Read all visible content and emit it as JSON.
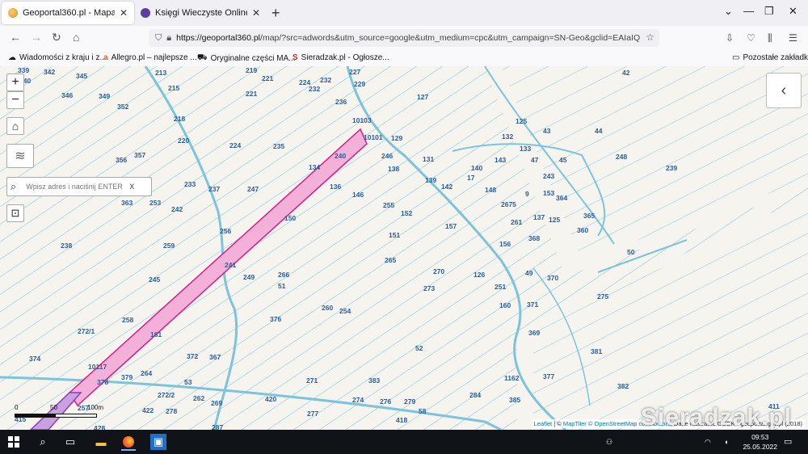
{
  "tabs": [
    {
      "title": "Geoportal360.pl - Mapa Interakt",
      "close": "✕",
      "active": true,
      "icon_color": "#f3b33d"
    },
    {
      "title": "Księgi Wieczyste Online - Ogólne",
      "close": "✕",
      "active": false,
      "icon_color": "#5b3fa0"
    }
  ],
  "window": {
    "new_tab": "+",
    "minimize": "—",
    "restore": "❐",
    "close": "✕",
    "tabs_menu": "⌄"
  },
  "nav": {
    "back": "←",
    "forward": "→",
    "reload": "↻",
    "home": "⌂",
    "url_host": "https://geoportal360.pl",
    "url_path": "/map/?src=adwords&utm_source=google&utm_medium=cpc&utm_campaign=SN-Geo&gclid=EAIaIQ",
    "star": "☆",
    "icons": [
      "download-icon",
      "pocket-icon",
      "library-icon",
      "menu-icon"
    ]
  },
  "bookmarks": [
    {
      "label": "Wiadomości z kraju i z...",
      "icon": "☁"
    },
    {
      "label": "Allegro.pl – najlepsze ...",
      "icon": "a"
    },
    {
      "label": "Oryginalne części MA...",
      "icon": "⛟"
    },
    {
      "label": "Sieradzak.pl - Ogłosze...",
      "icon": "S"
    },
    {
      "label": "Pozostałe zakładki",
      "icon": "▭"
    }
  ],
  "map_controls": {
    "zoom_in": "+",
    "zoom_out": "−",
    "home": "⌂",
    "layers": "≋",
    "print": "⊡",
    "search_placeholder": "Wpisz adres i naciśnij ENTER",
    "search_clear": "X",
    "search_icon": "⌕",
    "side_toggle": "‹"
  },
  "scale": {
    "labels": [
      "0",
      "50",
      "100m"
    ]
  },
  "plots": [
    "339",
    "342",
    "345",
    "213",
    "219",
    "221",
    "227",
    "232",
    "224",
    "232",
    "229",
    "42",
    "340",
    "346",
    "349",
    "215",
    "221",
    "236",
    "127",
    "352",
    "218",
    "10103",
    "125",
    "43",
    "44",
    "129",
    "220",
    "224",
    "235",
    "10101",
    "132",
    "356",
    "357",
    "240",
    "246",
    "131",
    "133",
    "45",
    "248",
    "138",
    "140",
    "143",
    "47",
    "239",
    "134",
    "139",
    "17",
    "243",
    "136",
    "142",
    "148",
    "9",
    "153",
    "364",
    "233",
    "237",
    "247",
    "146",
    "2675",
    "363",
    "253",
    "255",
    "152",
    "137",
    "125",
    "365",
    "242",
    "150",
    "261",
    "157",
    "360",
    "238",
    "256",
    "151",
    "156",
    "368",
    "259",
    "50",
    "241",
    "265",
    "270",
    "126",
    "49",
    "370",
    "245",
    "249",
    "266",
    "273",
    "251",
    "51",
    "275",
    "160",
    "371",
    "258",
    "260",
    "254",
    "376",
    "161",
    "369",
    "272/1",
    "52",
    "381",
    "372",
    "367",
    "374",
    "10117",
    "1162",
    "377",
    "378",
    "379",
    "264",
    "271",
    "383",
    "53",
    "382",
    "272/2",
    "274",
    "276",
    "279",
    "284",
    "385",
    "262",
    "420",
    "422",
    "278",
    "58",
    "411",
    "415",
    "257",
    "269",
    "277",
    "418",
    "428",
    "287"
  ],
  "attribution": {
    "leaflet": "Leaflet",
    "sep": " | © ",
    "maptiler": "MapTiler",
    "osm": "© OpenStreetMap contributors",
    "rest": ", Dane Kastralne GUGK - geoportal.gov.pl (2018)"
  },
  "watermark": "Sieradzak.pl",
  "taskbar": {
    "time": "09:53",
    "date": "25.05.2022",
    "tray": [
      "people-icon",
      "wifi-icon",
      "volume-icon"
    ],
    "notification": "▭"
  }
}
